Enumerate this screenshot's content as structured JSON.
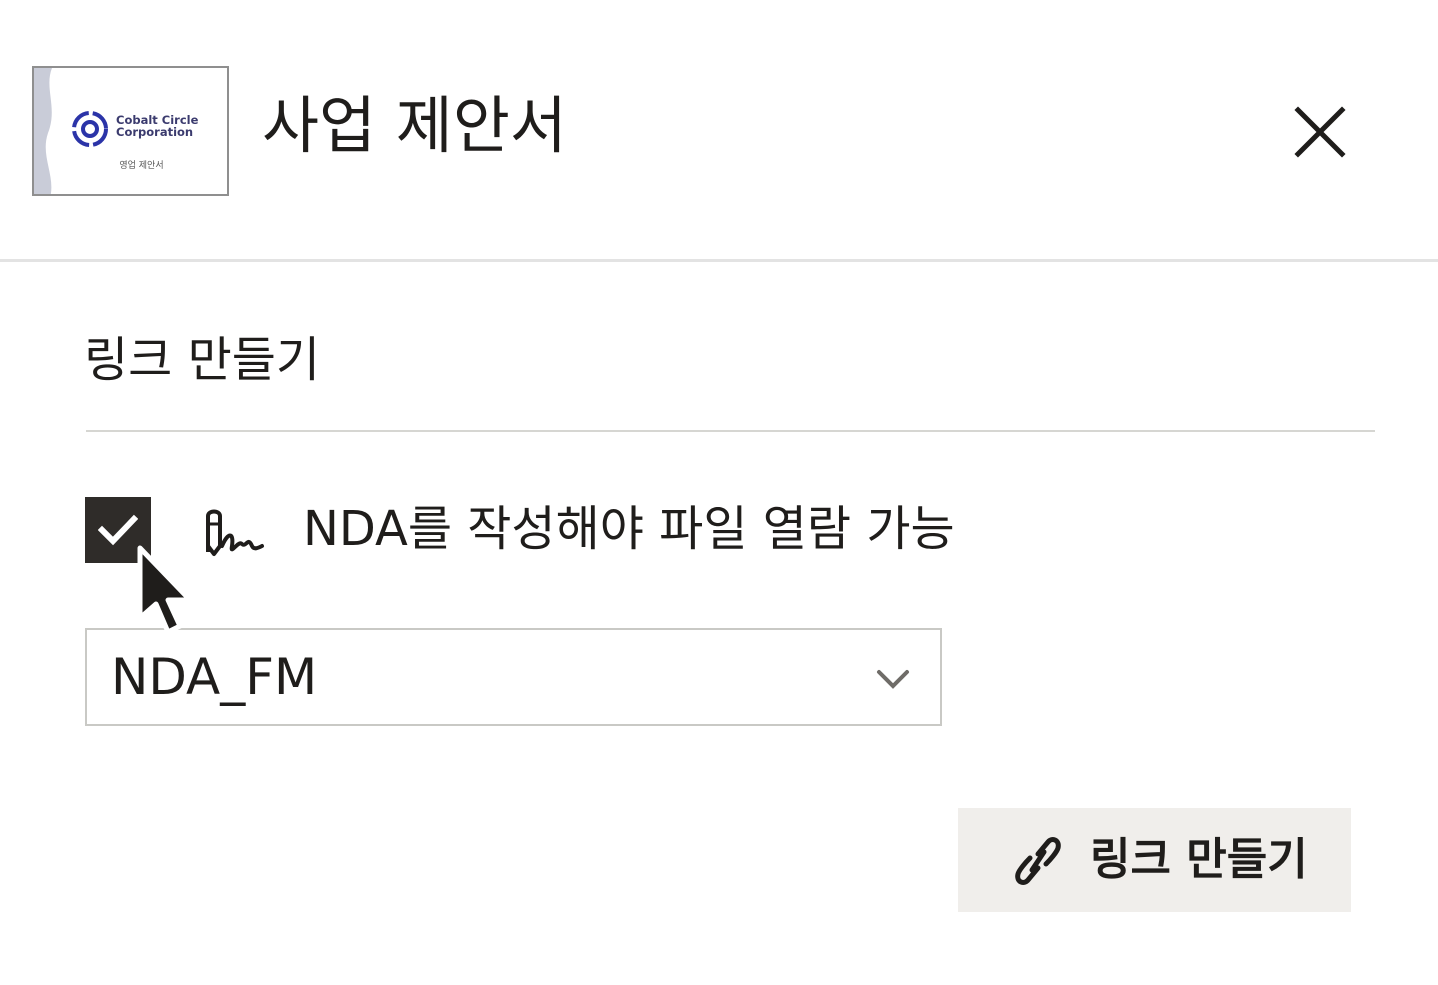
{
  "header": {
    "title": "사업 제안서",
    "thumbnail": {
      "company_line1": "Cobalt Circle",
      "company_line2": "Corporation",
      "subtitle": "영업 제안서",
      "brand_color": "#2b34a8"
    },
    "close_icon": "close-icon"
  },
  "section": {
    "title": "링크 만들기"
  },
  "nda_option": {
    "checked": true,
    "icon": "signature-icon",
    "label": "NDA를 작성해야 파일 열람 가능"
  },
  "nda_select": {
    "selected": "NDA_FM",
    "icon": "chevron-down-icon"
  },
  "create_link_button": {
    "label": "링크 만들기",
    "icon": "link-icon"
  },
  "colors": {
    "text": "#1f1d1b",
    "checkbox_fill": "#2f2c29",
    "button_bg": "#f0eeeb",
    "border": "#c9c9c5",
    "divider": "#e3e3e3"
  }
}
